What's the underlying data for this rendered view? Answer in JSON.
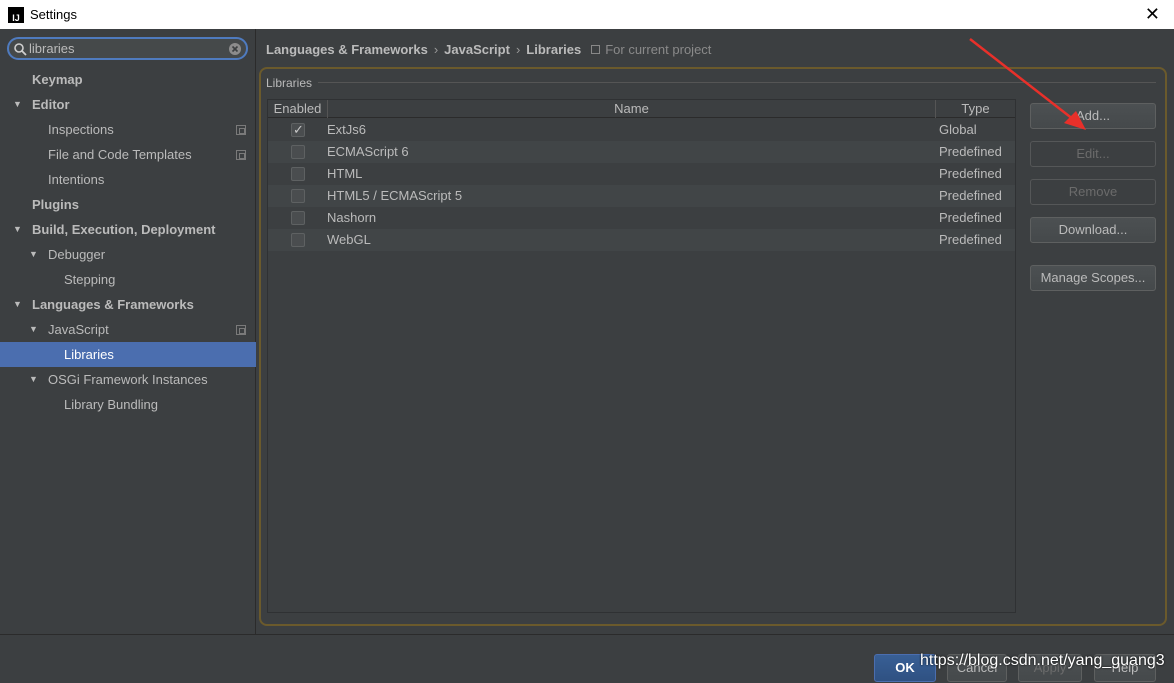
{
  "window": {
    "title": "Settings",
    "app_icon_text": "IJ"
  },
  "search": {
    "value": "libraries"
  },
  "tree": [
    {
      "label": "Keymap",
      "bold": true,
      "arrow": "",
      "level": 0
    },
    {
      "label": "Editor",
      "bold": true,
      "arrow": "▼",
      "level": 0
    },
    {
      "label": "Inspections",
      "bold": false,
      "arrow": "",
      "level": 1,
      "copy": true
    },
    {
      "label": "File and Code Templates",
      "bold": false,
      "arrow": "",
      "level": 1,
      "copy": true
    },
    {
      "label": "Intentions",
      "bold": false,
      "arrow": "",
      "level": 1
    },
    {
      "label": "Plugins",
      "bold": true,
      "arrow": "",
      "level": 0
    },
    {
      "label": "Build, Execution, Deployment",
      "bold": true,
      "arrow": "▼",
      "level": 0
    },
    {
      "label": "Debugger",
      "bold": false,
      "arrow": "▼",
      "level": 1
    },
    {
      "label": "Stepping",
      "bold": false,
      "arrow": "",
      "level": 2
    },
    {
      "label": "Languages & Frameworks",
      "bold": true,
      "arrow": "▼",
      "level": 0
    },
    {
      "label": "JavaScript",
      "bold": false,
      "arrow": "▼",
      "level": 1,
      "copy": true
    },
    {
      "label": "Libraries",
      "bold": false,
      "arrow": "",
      "level": 2,
      "selected": true
    },
    {
      "label": "OSGi Framework Instances",
      "bold": false,
      "arrow": "▼",
      "level": 1
    },
    {
      "label": "Library Bundling",
      "bold": false,
      "arrow": "",
      "level": 2
    }
  ],
  "breadcrumb": {
    "items": [
      "Languages & Frameworks",
      "JavaScript",
      "Libraries"
    ],
    "separator": "›",
    "scope": "For current project"
  },
  "libraries": {
    "group_title": "Libraries",
    "columns": {
      "enabled": "Enabled",
      "name": "Name",
      "type": "Type"
    },
    "rows": [
      {
        "enabled": true,
        "name": "ExtJs6",
        "type": "Global"
      },
      {
        "enabled": false,
        "name": "ECMAScript 6",
        "type": "Predefined"
      },
      {
        "enabled": false,
        "name": "HTML",
        "type": "Predefined"
      },
      {
        "enabled": false,
        "name": "HTML5 / ECMAScript 5",
        "type": "Predefined"
      },
      {
        "enabled": false,
        "name": "Nashorn",
        "type": "Predefined"
      },
      {
        "enabled": false,
        "name": "WebGL",
        "type": "Predefined"
      }
    ]
  },
  "actions": {
    "add": "Add...",
    "edit": "Edit...",
    "remove": "Remove",
    "download": "Download...",
    "manage_scopes": "Manage Scopes..."
  },
  "footer": {
    "ok": "OK",
    "cancel": "Cancel",
    "apply": "Apply",
    "help": "Help",
    "watermark": "https://blog.csdn.net/yang_guang3"
  },
  "colors": {
    "background": "#3c3f41",
    "selection": "#4b6eaf",
    "annotation_arrow": "#e8302a"
  }
}
